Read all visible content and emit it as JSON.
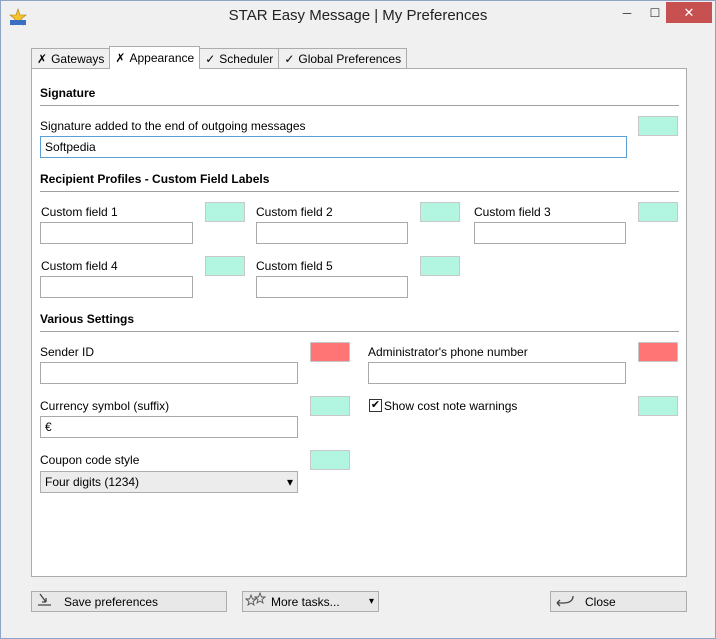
{
  "window": {
    "title": "STAR Easy Message | My Preferences"
  },
  "titlebar": {
    "minimize": "─",
    "maximize": "☐",
    "close": "✕"
  },
  "tabs": [
    {
      "mark": "✗",
      "label": "Gateways"
    },
    {
      "mark": "✗",
      "label": "Appearance"
    },
    {
      "mark": "✓",
      "label": "Scheduler"
    },
    {
      "mark": "✓",
      "label": "Global Preferences"
    }
  ],
  "signature": {
    "title": "Signature",
    "label": "Signature added to the end of outgoing messages",
    "value": "Softpedia"
  },
  "custom_fields": {
    "title": "Recipient Profiles - Custom Field Labels",
    "fields": [
      {
        "label": "Custom field 1",
        "value": ""
      },
      {
        "label": "Custom field 2",
        "value": ""
      },
      {
        "label": "Custom field 3",
        "value": ""
      },
      {
        "label": "Custom field 4",
        "value": ""
      },
      {
        "label": "Custom field 5",
        "value": ""
      }
    ]
  },
  "various": {
    "title": "Various Settings",
    "sender_id": {
      "label": "Sender ID",
      "value": ""
    },
    "admin_phone": {
      "label": "Administrator's phone number",
      "value": ""
    },
    "currency": {
      "label": "Currency symbol (suffix)",
      "value": "€"
    },
    "cost_warnings": {
      "label": "Show cost note warnings",
      "checked": "✔"
    },
    "coupon": {
      "label": "Coupon code style",
      "selected": "Four digits (1234)",
      "arrow": "▾"
    }
  },
  "colors": {
    "valid": "#b2f5e0",
    "invalid": "#ff7474"
  },
  "buttons": {
    "save": {
      "label": "Save preferences",
      "icon": "download-arrow-icon"
    },
    "more": {
      "label": "More tasks...",
      "icon": "stars-icon",
      "arrow": "▾"
    },
    "close": {
      "label": "Close",
      "icon": "return-arrow-icon"
    }
  }
}
